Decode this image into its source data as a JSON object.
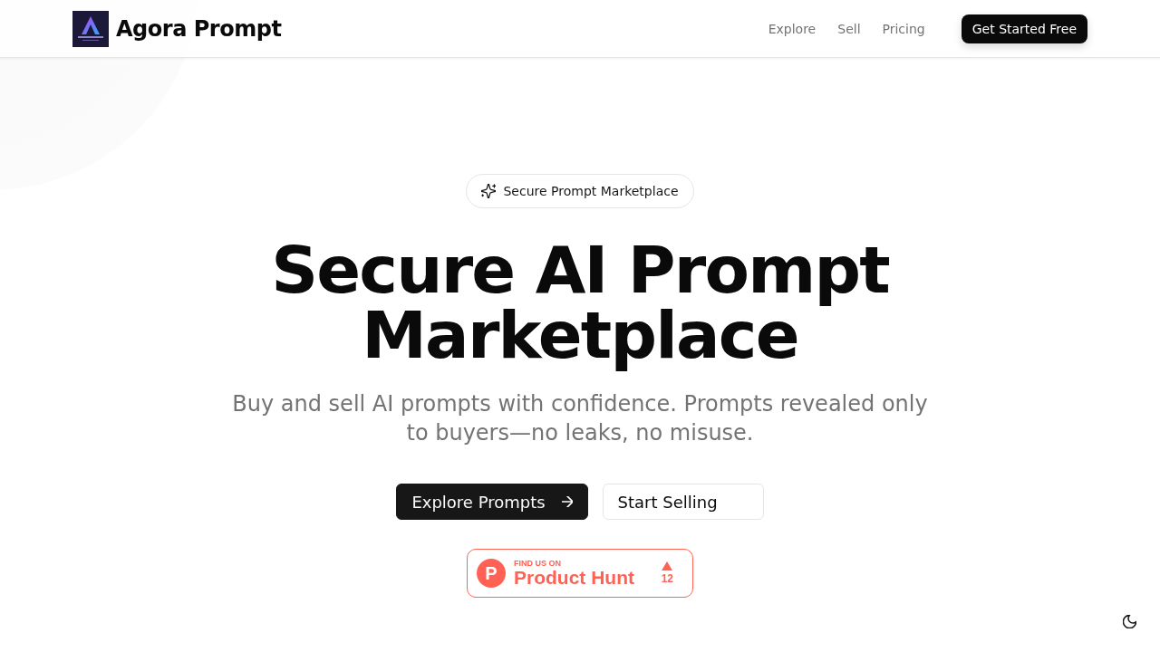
{
  "header": {
    "brand": "Agora Prompt",
    "nav": [
      {
        "label": "Explore"
      },
      {
        "label": "Sell"
      },
      {
        "label": "Pricing"
      }
    ],
    "cta": "Get Started Free"
  },
  "hero": {
    "badge": "Secure Prompt Marketplace",
    "title": "Secure AI Prompt Marketplace",
    "subtitle": "Buy and sell AI prompts with confidence. Prompts revealed only to buyers—no leaks, no misuse.",
    "buttons": [
      {
        "label": "Explore Prompts",
        "kind": "primary"
      },
      {
        "label": "Start Selling",
        "kind": "secondary"
      }
    ]
  },
  "product_hunt": {
    "logo_letter": "P",
    "eyebrow": "FIND US ON",
    "name": "Product Hunt",
    "upvotes": "12"
  }
}
